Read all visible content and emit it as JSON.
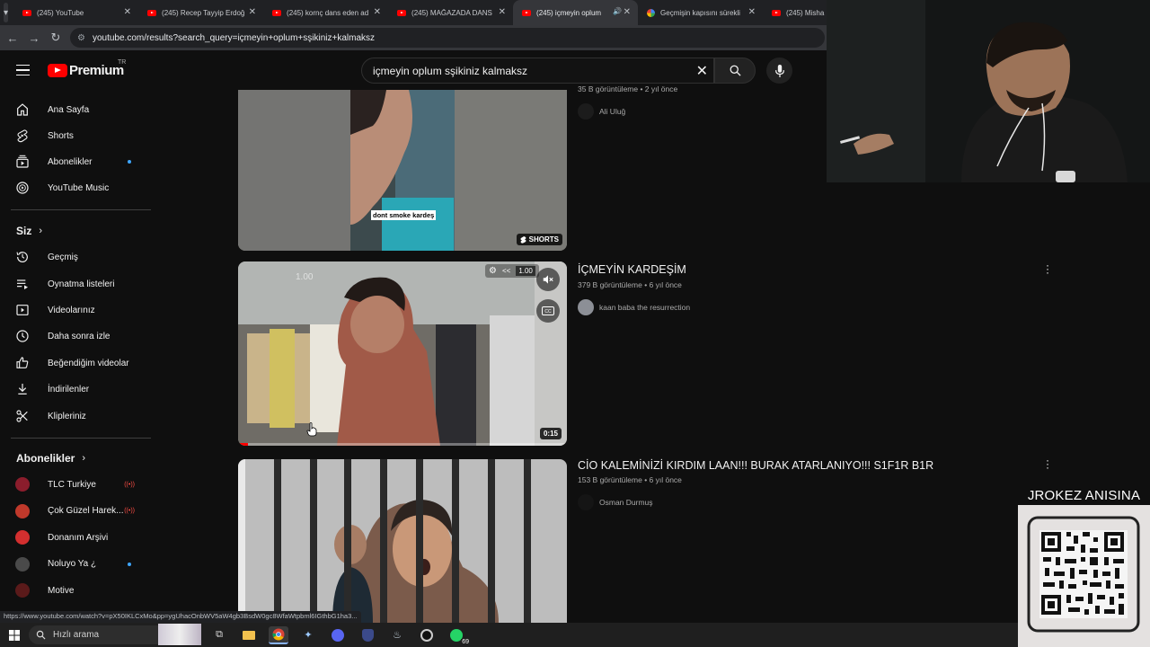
{
  "browser": {
    "tabs": [
      {
        "title": "(245) YouTube",
        "favicon": "youtube-icon",
        "active": false
      },
      {
        "title": "(245) Recep Tayyip Erdoğ",
        "favicon": "youtube-icon",
        "active": false
      },
      {
        "title": "(245) kornç dans eden ad",
        "favicon": "youtube-icon",
        "active": false
      },
      {
        "title": "(245) MAĞAZADA DANS",
        "favicon": "youtube-icon",
        "active": false
      },
      {
        "title": "(245) içmeyin oplum",
        "favicon": "youtube-icon",
        "active": true
      },
      {
        "title": "Geçmişin kapısını sürekli",
        "favicon": "google-icon",
        "active": false
      },
      {
        "title": "(245) Misha",
        "favicon": "youtube-icon",
        "active": false
      }
    ],
    "url": "youtube.com/results?search_query=içmeyin+oplum+sşikiniz+kalmaksz",
    "status_url": "https://www.youtube.com/watch?v=pX50IKLCxMo&pp=ygUhacOnbWV5aW4gb3BsdW0gc8WfaWtpbml6IGthbG1ha3..."
  },
  "masthead": {
    "logo_text": "Premium",
    "country_code": "TR",
    "search_value": "içmeyin oplum sşikiniz kalmaksz"
  },
  "sidebar": {
    "main": [
      {
        "label": "Ana Sayfa",
        "icon": "home-icon"
      },
      {
        "label": "Shorts",
        "icon": "shorts-icon"
      },
      {
        "label": "Abonelikler",
        "icon": "subscriptions-icon",
        "dot": true
      },
      {
        "label": "YouTube Music",
        "icon": "music-icon"
      }
    ],
    "you_heading": "Siz",
    "you": [
      {
        "label": "Geçmiş",
        "icon": "history-icon"
      },
      {
        "label": "Oynatma listeleri",
        "icon": "playlists-icon"
      },
      {
        "label": "Videolarınız",
        "icon": "your-videos-icon"
      },
      {
        "label": "Daha sonra izle",
        "icon": "watch-later-icon"
      },
      {
        "label": "Beğendiğim videolar",
        "icon": "like-icon"
      },
      {
        "label": "İndirilenler",
        "icon": "download-icon"
      },
      {
        "label": "Klipleriniz",
        "icon": "clips-icon"
      }
    ],
    "subs_heading": "Abonelikler",
    "subs": [
      {
        "label": "TLC Turkiye",
        "color": "#8b1d2c",
        "live": true
      },
      {
        "label": "Çok Güzel Harek...",
        "color": "#c0392b",
        "live": true
      },
      {
        "label": "Donanım Arşivi",
        "color": "#d32f2f",
        "live": false
      },
      {
        "label": "Noluyo Ya ¿",
        "color": "#4a4a4a",
        "dot": true
      },
      {
        "label": "Motive",
        "color": "#5a1a1a",
        "live": false
      }
    ]
  },
  "results": [
    {
      "meta": "35 B görüntüleme • 2 yıl önce",
      "channel": "Ali Uluğ",
      "overlay_caption": "dont smoke kardeş",
      "badge": "SHORTS"
    },
    {
      "title": "İÇMEYİN KARDEŞİM",
      "meta": "379 B görüntüleme • 6 yıl önce",
      "channel": "kaan baba the resurrection",
      "duration": "0:15",
      "speed_label": "1.00",
      "speed_ghost": "1.00",
      "rewind_label": "<<",
      "progress": 0.03
    },
    {
      "title": "CİO KALEMİNİZİ KIRDIM LAAN!!! BURAK ATARLANIYO!!! S1F1R B1R",
      "meta": "153 B görüntüleme • 6 yıl önce",
      "channel": "Osman Durmuş"
    }
  ],
  "overlay": {
    "qr_caption": "JROKEZ ANISINA"
  },
  "taskbar": {
    "search_placeholder": "Hızlı arama",
    "badge_count": "69"
  },
  "colors": {
    "background": "#0f0f0f",
    "youtube_red": "#ff0000",
    "accent_blue": "#3ea6ff",
    "live_red": "#ff4e45"
  }
}
